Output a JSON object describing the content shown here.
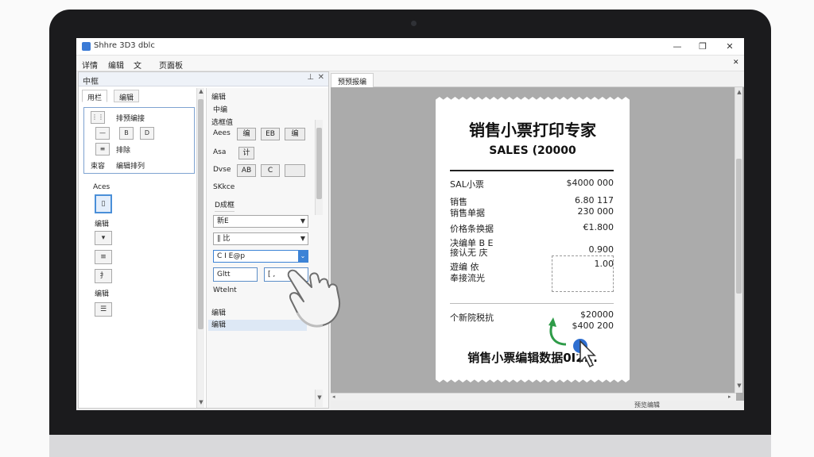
{
  "window": {
    "title": "Shhre 3D3 dblc",
    "minimize": "—",
    "maximize": "❐",
    "close": "✕"
  },
  "menu": [
    "详情",
    "编辑",
    "文",
    "页面板"
  ],
  "left_panel": {
    "title": "中框",
    "pin": "⊥",
    "close": "✕",
    "tabs": [
      "用栏",
      "编辑"
    ],
    "tool_rows": [
      {
        "icon": "⋮⋮",
        "label": "排预编接"
      },
      {
        "icon": "—",
        "icon2": "B",
        "icon3": "D",
        "label": ""
      },
      {
        "icon": "≡",
        "label": "排除"
      },
      {
        "icon": "束容",
        "label": "编辑排列"
      }
    ],
    "vtools_label": "Aces",
    "vtool_items": [
      {
        "glyph": "▯",
        "label": "编辑"
      },
      {
        "glyph": "▾",
        "label": ""
      },
      {
        "glyph": "≡",
        "label": ""
      },
      {
        "glyph": "扌",
        "label": "编辑"
      },
      {
        "glyph": "☰",
        "label": ""
      }
    ]
  },
  "props": {
    "heading1": "编辑",
    "heading2": "中编",
    "heading3": "选框值",
    "row1_label": "Aees",
    "row1_btns": [
      "编",
      "EB",
      "编"
    ],
    "row2_label": "Asa",
    "row2_btns": [
      "计"
    ],
    "row3_label": "Dvse",
    "row3_btns": [
      "AB",
      "C",
      ""
    ],
    "row4_label": "SKkce",
    "group_label": "D成框",
    "select1": "新E",
    "select2": "∥ 比",
    "select3": "C I E@p",
    "input1": "Gltt",
    "input2": "[ ,",
    "weight_label": "Wtelnt",
    "section_label": "编辑",
    "highlight_item": "编辑"
  },
  "doc": {
    "tab": "预预报编",
    "zoom": "预览编辑"
  },
  "receipt": {
    "title": "销售小票打印专家",
    "subtitle": "SALES (20000",
    "rows": [
      {
        "left": "SAL小票",
        "right": "$4000 000"
      },
      {
        "left": "销售",
        "right": "6.80 117"
      },
      {
        "left": "销售单据",
        "right": "230 000"
      },
      {
        "left": "价格条换据",
        "right": "€1.800"
      },
      {
        "left": "决编单 B E",
        "right": ""
      },
      {
        "left": "接认无       庆",
        "right": "0.900"
      },
      {
        "left": "遊编 依",
        "right": "1.00"
      },
      {
        "left": "奉接流光",
        "right": ""
      }
    ],
    "total_label": "个新院税抗",
    "total_values": [
      "$20000",
      "$400 200"
    ],
    "footer": "销售小票编辑数据0I2..."
  }
}
